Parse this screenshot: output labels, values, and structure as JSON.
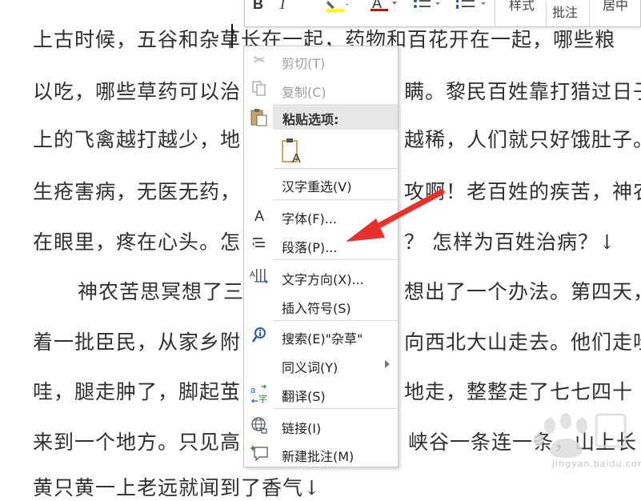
{
  "document": {
    "lines": [
      "上古时候，五谷和杂草长在一起，药物和百花开在一起，哪些粮",
      "以吃，哪些草药可以治",
      "瞒。黎民百姓靠打猎过日子",
      "上的飞禽越打越少，地",
      "越稀，人们就只好饿肚子。",
      "生疮害病，无医无药，",
      "攻啊！老百姓的疾苦，神农",
      "在眼里，疼在心头。怎",
      "？ 怎样为百姓治病？↓",
      "神农苦思冥想了三",
      "想出了一个办法。第四天，",
      "着一批臣民，从家乡附",
      "向西北大山走去。他们走哇",
      "哇，腿走肿了，脚起茧",
      "地走，整整走了七七四十",
      "来到一个地方。只见高",
      "峡谷一条连一条，山上长",
      "黄只黄一上老远就闻到了香气↓"
    ]
  },
  "toolbar": {
    "bold": "B",
    "italic": "I",
    "font_color": "A",
    "style_label": "样式",
    "comment_label": "批注",
    "center_label": "居中"
  },
  "context_menu": {
    "cut": "剪切(T)",
    "copy": "复制(C)",
    "paste_options": "粘贴选项:",
    "reconvert": "汉字重选(V)",
    "font": "字体(F)...",
    "paragraph": "段落(P)...",
    "text_direction": "文字方向(X)...",
    "insert_symbol": "插入符号(S)",
    "search": "搜索(E)\"杂草\"",
    "synonyms": "同义词(Y)",
    "translate": "翻译(S)",
    "link": "链接(I)",
    "new_comment": "新建批注(M)"
  },
  "watermark": {
    "site": "jingyan.baidu.com"
  },
  "colors": {
    "highlight": "#ffff00",
    "font_red": "#e00000",
    "arrow_red": "#e8302c"
  }
}
